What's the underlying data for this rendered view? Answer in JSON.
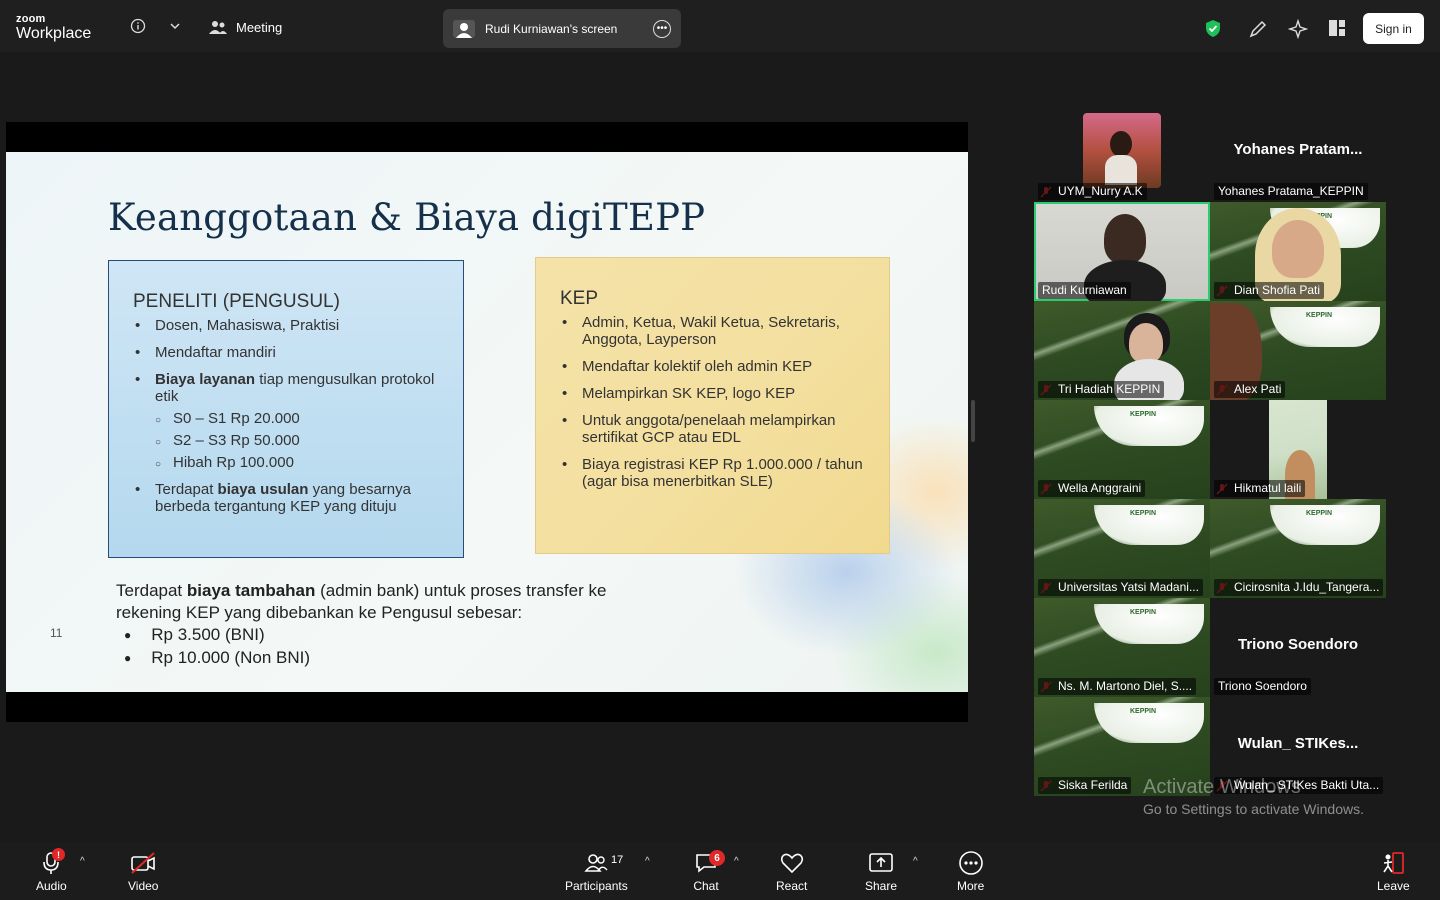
{
  "app": {
    "logo_line1": "zoom",
    "logo_line2": "Workplace",
    "meeting_label": "Meeting",
    "screen_share_label": "Rudi Kurniawan's screen",
    "sign_in": "Sign in",
    "accent_color": "#2ecc71"
  },
  "slide": {
    "title": "Keanggotaan & Biaya digiTEPP",
    "left_box": {
      "heading": "PENELITI (PENGUSUL)",
      "b1": "Dosen, Mahasiswa, Praktisi",
      "b2": "Mendaftar mandiri",
      "b3_bold": "Biaya layanan",
      "b3_rest": " tiap mengusulkan protokol etik",
      "s1": "S0 – S1 Rp 20.000",
      "s2": "S2 – S3 Rp 50.000",
      "s3": "Hibah Rp 100.000",
      "b4_pre": "Terdapat ",
      "b4_bold": "biaya usulan",
      "b4_rest": " yang besarnya berbeda tergantung KEP yang dituju"
    },
    "right_box": {
      "heading": "KEP",
      "b1": "Admin, Ketua, Wakil Ketua, Sekretaris, Anggota, Layperson",
      "b2": "Mendaftar kolektif oleh admin KEP",
      "b3": "Melampirkan SK KEP, logo KEP",
      "b4": "Untuk anggota/penelaah melampirkan sertifikat GCP atau EDL",
      "b5": "Biaya registrasi KEP Rp 1.000.000 / tahun (agar bisa menerbitkan SLE)"
    },
    "extra_pre": "Terdapat ",
    "extra_bold": "biaya tambahan",
    "extra_rest": " (admin bank) untuk proses  transfer ke rekening KEP yang dibebankan ke Pengusul sebesar:",
    "fee1": "Rp 3.500 (BNI)",
    "fee2": "Rp 10.000 (Non BNI)",
    "page_number": "11"
  },
  "participants": [
    {
      "name": "UYM_Nurry A.K"
    },
    {
      "name": "Yohanes Pratama_KEPPIN",
      "display": "Yohanes  Pratam..."
    },
    {
      "name": "Rudi Kurniawan"
    },
    {
      "name": "Dian Shofia Pati"
    },
    {
      "name": "Tri Hadiah KEPPIN"
    },
    {
      "name": "Alex  Pati"
    },
    {
      "name": "Wella Anggraini"
    },
    {
      "name": "Hikmatul laili"
    },
    {
      "name": "Universitas Yatsi Madani..."
    },
    {
      "name": "Cicirosnita J.Idu_Tangera..."
    },
    {
      "name": "Ns. M. Martono Diel, S...."
    },
    {
      "name": "Triono Soendoro",
      "display": "Triono Soendoro"
    },
    {
      "name": "Siska Ferilda"
    },
    {
      "name": "Wulan_ STIKes Bakti Uta...",
      "display": "Wulan_  STIKes..."
    }
  ],
  "tile_banner": "KEPPIN",
  "watermark": {
    "line1": "Activate Windows",
    "line2": "Go to Settings to activate Windows."
  },
  "toolbar": {
    "audio": "Audio",
    "audio_badge": "!",
    "video": "Video",
    "participants": "Participants",
    "participants_count": "17",
    "chat": "Chat",
    "chat_badge": "6",
    "react": "React",
    "share": "Share",
    "more": "More",
    "leave": "Leave"
  }
}
